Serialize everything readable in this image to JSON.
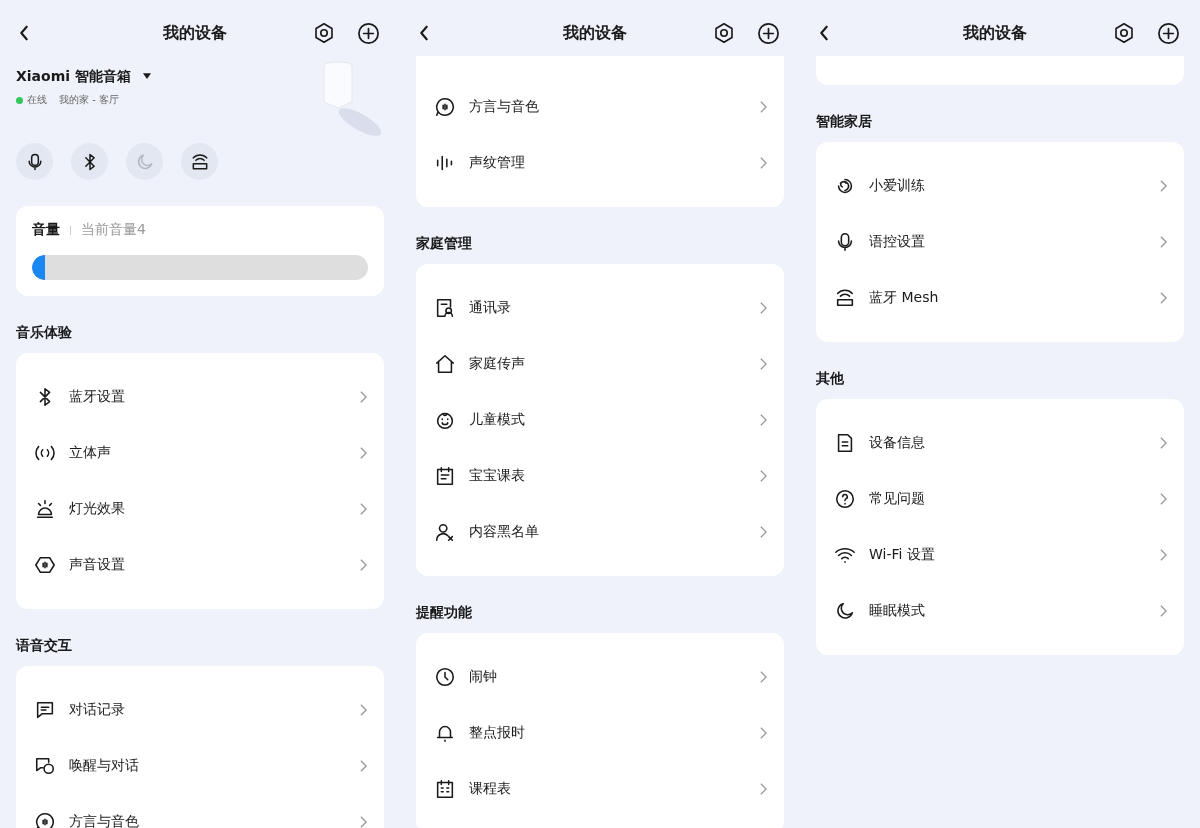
{
  "panels": [
    {
      "title": "我的设备",
      "leading_card_end": false,
      "device": {
        "name": "Xiaomi 智能音箱",
        "status": "在线",
        "location": "我的家 - 客厅",
        "quick_buttons": [
          {
            "kind": "mic",
            "enabled": true
          },
          {
            "kind": "bluetooth",
            "enabled": true
          },
          {
            "kind": "moon",
            "enabled": false
          },
          {
            "kind": "mesh",
            "enabled": true
          }
        ],
        "volume": {
          "label": "音量",
          "reading": "当前音量4",
          "level": 0.04
        }
      },
      "sections": [
        {
          "title": "音乐体验",
          "cut_top": false,
          "items": [
            {
              "label": "蓝牙设置",
              "kind": "bluetooth"
            },
            {
              "label": "立体声",
              "kind": "stereo"
            },
            {
              "label": "灯光效果",
              "kind": "lamp"
            },
            {
              "label": "声音设置",
              "kind": "sound"
            }
          ]
        },
        {
          "title": "语音交互",
          "cut_top": false,
          "items": [
            {
              "label": "对话记录",
              "kind": "chat"
            },
            {
              "label": "唤醒与对话",
              "kind": "bubbles"
            },
            {
              "label": "方言与音色",
              "kind": "dialect"
            }
          ]
        }
      ]
    },
    {
      "title": "我的设备",
      "leading_card_end": false,
      "sections": [
        {
          "cut_top": true,
          "items": [
            {
              "label": "方言与音色",
              "kind": "dialect"
            },
            {
              "label": "声纹管理",
              "kind": "voiceprint"
            }
          ]
        },
        {
          "title": "家庭管理",
          "cut_top": false,
          "items": [
            {
              "label": "通讯录",
              "kind": "contacts"
            },
            {
              "label": "家庭传声",
              "kind": "home"
            },
            {
              "label": "儿童模式",
              "kind": "baby"
            },
            {
              "label": "宝宝课表",
              "kind": "calendar"
            },
            {
              "label": "内容黑名单",
              "kind": "userx"
            }
          ]
        },
        {
          "title": "提醒功能",
          "cut_top": false,
          "items": [
            {
              "label": "闹钟",
              "kind": "clock"
            },
            {
              "label": "整点报时",
              "kind": "bell"
            },
            {
              "label": "课程表",
              "kind": "grid"
            }
          ]
        }
      ]
    },
    {
      "title": "我的设备",
      "leading_card_end": true,
      "sections": [
        {
          "title": "智能家居",
          "cut_top": false,
          "items": [
            {
              "label": "小爱训练",
              "kind": "spiral"
            },
            {
              "label": "语控设置",
              "kind": "mic"
            },
            {
              "label": "蓝牙 Mesh",
              "kind": "mesh"
            }
          ]
        },
        {
          "title": "其他",
          "cut_top": false,
          "items": [
            {
              "label": "设备信息",
              "kind": "doc"
            },
            {
              "label": "常见问题",
              "kind": "question"
            },
            {
              "label": "Wi-Fi 设置",
              "kind": "wifi"
            },
            {
              "label": "睡眠模式",
              "kind": "moon"
            }
          ]
        }
      ]
    }
  ]
}
